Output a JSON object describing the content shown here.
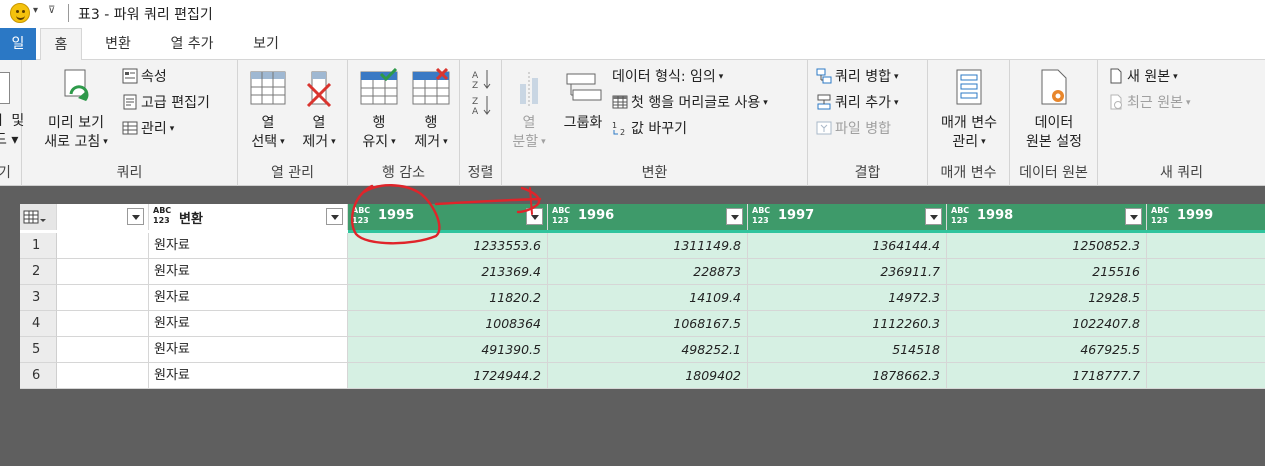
{
  "titlebar": {
    "title": "표3 - 파워 쿼리 편집기",
    "dropdown_glyph": "▾",
    "customize_glyph": "⊽"
  },
  "tabs": {
    "file": "일",
    "home": "홈",
    "transform": "변환",
    "add_column": "열 추가",
    "view": "보기"
  },
  "ribbon": {
    "close": {
      "line1": "ㅣ 및",
      "line2": "드 ▾",
      "label": "기"
    },
    "query": {
      "label": "쿼리",
      "refresh_line1": "미리 보기",
      "refresh_line2": "새로 고침",
      "properties": "속성",
      "advanced_editor": "고급 편집기",
      "manage": "관리"
    },
    "manage_columns": {
      "label": "열 관리",
      "choose_line1": "열",
      "choose_line2": "선택",
      "remove_line1": "열",
      "remove_line2": "제거"
    },
    "reduce_rows": {
      "label": "행 감소",
      "keep_line1": "행",
      "keep_line2": "유지",
      "remove_line1": "행",
      "remove_line2": "제거"
    },
    "sort": {
      "label": "정렬"
    },
    "transform": {
      "label": "변환",
      "split_line1": "열",
      "split_line2": "분할",
      "group_by": "그룹화",
      "data_type": "데이터 형식: 임의",
      "first_row_header": "첫 행을 머리글로 사용",
      "replace_values": "값 바꾸기"
    },
    "combine": {
      "label": "결합",
      "merge_queries": "쿼리 병합",
      "append_queries": "쿼리 추가",
      "combine_files": "파일 병합"
    },
    "parameters": {
      "label": "매개 변수",
      "manage_line1": "매개 변수",
      "manage_line2": "관리"
    },
    "data_sources": {
      "label": "데이터 원본",
      "settings_line1": "데이터",
      "settings_line2": "원본 설정"
    },
    "new_query": {
      "label": "새 쿼리",
      "new_source": "새 원본",
      "recent_sources": "최근 원본"
    }
  },
  "table": {
    "type_abc": "ABC",
    "type_123": "123",
    "columns": [
      {
        "name": ""
      },
      {
        "name": "변환"
      },
      {
        "name": "1995"
      },
      {
        "name": "1996"
      },
      {
        "name": "1997"
      },
      {
        "name": "1998"
      },
      {
        "name": "1999"
      }
    ],
    "rows": [
      {
        "index": "1",
        "label": "원자료",
        "v1995": "1233553.6",
        "v1996": "1311149.8",
        "v1997": "1364144.4",
        "v1998": "1250852.3"
      },
      {
        "index": "2",
        "label": "원자료",
        "v1995": "213369.4",
        "v1996": "228873",
        "v1997": "236911.7",
        "v1998": "215516"
      },
      {
        "index": "3",
        "label": "원자료",
        "v1995": "11820.2",
        "v1996": "14109.4",
        "v1997": "14972.3",
        "v1998": "12928.5"
      },
      {
        "index": "4",
        "label": "원자료",
        "v1995": "1008364",
        "v1996": "1068167.5",
        "v1997": "1112260.3",
        "v1998": "1022407.8"
      },
      {
        "index": "5",
        "label": "원자료",
        "v1995": "491390.5",
        "v1996": "498252.1",
        "v1997": "514518",
        "v1998": "467925.5"
      },
      {
        "index": "6",
        "label": "원자료",
        "v1995": "1724944.2",
        "v1996": "1809402",
        "v1997": "1878662.3",
        "v1998": "1718777.7"
      }
    ]
  },
  "colors": {
    "accent_blue": "#2b78c5",
    "header_green": "#3e9a6a",
    "cell_green": "#d6f0e3",
    "annotation_red": "#e0242a"
  }
}
